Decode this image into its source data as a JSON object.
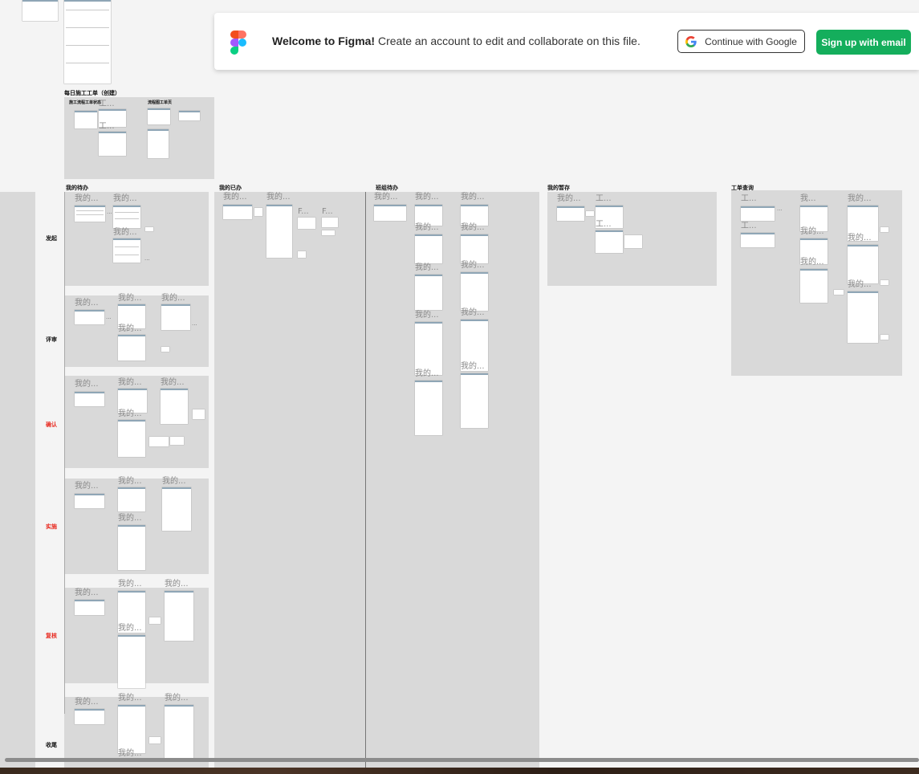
{
  "banner": {
    "welcome_strong": "Welcome to Figma!",
    "welcome_rest": " Create an account to edit and collaborate on this file.",
    "google_button": "Continue with Google",
    "email_button": "Sign up with email"
  },
  "canvas": {
    "top_section_title": "每日施工工单（创建）",
    "top_sub1": "施工流程工单状态",
    "top_sub2": "流程图工单页",
    "top_frame1": "工...",
    "top_frame2": "工...",
    "columns": [
      {
        "title": "我的待办"
      },
      {
        "title": "我的已办"
      },
      {
        "title": "班组待办"
      },
      {
        "title": "我的暂存"
      },
      {
        "title": "工单查询"
      }
    ],
    "lanes": [
      {
        "label": "发起",
        "color": "#111111"
      },
      {
        "label": "评审",
        "color": "#111111"
      },
      {
        "label": "确认",
        "color": "#e8281e"
      },
      {
        "label": "实施",
        "color": "#e8281e"
      },
      {
        "label": "复核",
        "color": "#e8281e"
      },
      {
        "label": "收尾",
        "color": "#111111"
      }
    ],
    "frame_label_mine": "我的...",
    "frame_label_work": "工...",
    "frame_label_f": "F...",
    "frame_label_me": "我..."
  }
}
